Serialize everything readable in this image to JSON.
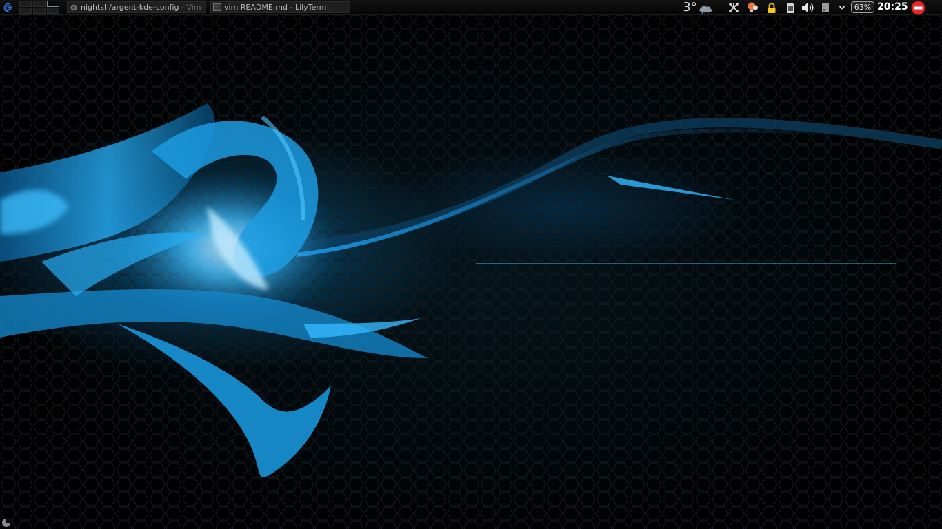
{
  "taskbar": {
    "tasks": [
      {
        "title": "nightsh/argent-kde-config",
        "title_dim": " - Vim",
        "icon": "vim-icon"
      },
      {
        "title": "vim README.md - LilyTerm",
        "icon": "terminal-icon"
      }
    ],
    "pager": {
      "desktops": 6,
      "active": 3
    }
  },
  "tray": {
    "weather": {
      "temperature": "3°",
      "icon": "cloud-icon"
    },
    "icons": [
      "network-icon",
      "notifications-icon",
      "lock-icon",
      "sd-card-icon",
      "volume-icon",
      "device-icon",
      "chevron-down-icon"
    ],
    "battery": {
      "percent": "63%"
    },
    "clock": "20:25",
    "logout_icon": "logout-icon"
  },
  "wallpaper": {
    "accent": "#1aa7ff",
    "background": "#000000"
  }
}
